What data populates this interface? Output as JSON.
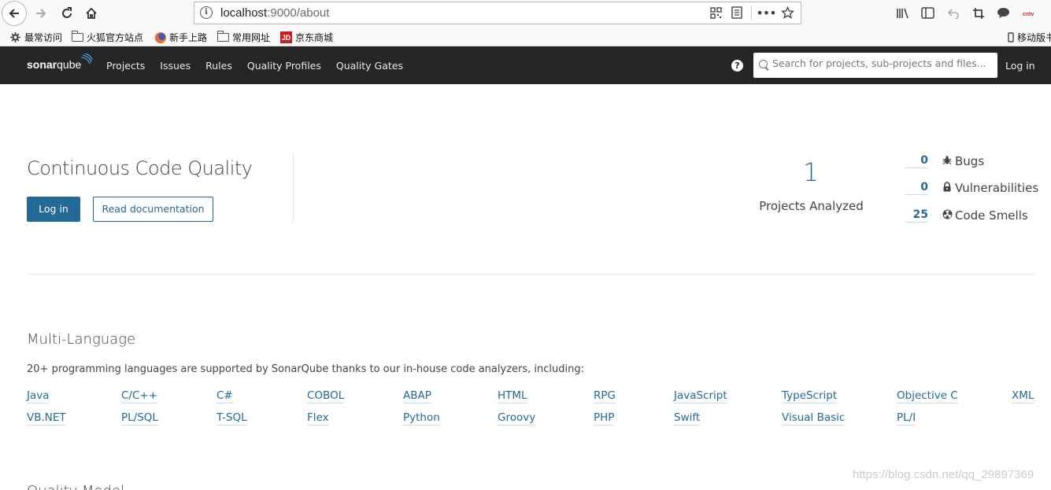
{
  "browser": {
    "url_host": "localhost",
    "url_rest": ":9000/about",
    "bookmarks": [
      {
        "label": "最常访问",
        "icon": "gear-icon"
      },
      {
        "label": "火狐官方站点",
        "icon": "folder-icon"
      },
      {
        "label": "新手上路",
        "icon": "firefox-icon"
      },
      {
        "label": "常用网址",
        "icon": "folder-icon"
      },
      {
        "label": "京东商城",
        "icon": "jd-icon"
      },
      {
        "label": "移动版书",
        "icon": "mobile-icon"
      }
    ]
  },
  "nav": {
    "logo_bold": "sonar",
    "logo_rest": "qube",
    "items": [
      "Projects",
      "Issues",
      "Rules",
      "Quality Profiles",
      "Quality Gates"
    ],
    "search_placeholder": "Search for projects, sub-projects and files...",
    "login": "Log in"
  },
  "hero": {
    "title": "Continuous Code Quality",
    "login_button": "Log in",
    "docs_button": "Read documentation",
    "projects_count": "1",
    "projects_label": "Projects Analyzed",
    "metrics": [
      {
        "value": "0",
        "label": "Bugs",
        "icon": "bug-icon"
      },
      {
        "value": "0",
        "label": "Vulnerabilities",
        "icon": "lock-icon"
      },
      {
        "value": "25",
        "label": "Code Smells",
        "icon": "code-smell-icon"
      }
    ]
  },
  "languages": {
    "title": "Multi-Language",
    "description": "20+ programming languages are supported by SonarQube thanks to our in-house code analyzers, including:",
    "row1": [
      "Java",
      "C/C++",
      "C#",
      "COBOL",
      "ABAP",
      "HTML",
      "RPG",
      "JavaScript",
      "TypeScript",
      "Objective C",
      "XML"
    ],
    "row2": [
      "VB.NET",
      "PL/SQL",
      "T-SQL",
      "Flex",
      "Python",
      "Groovy",
      "PHP",
      "Swift",
      "Visual Basic",
      "PL/I"
    ]
  },
  "next_section_title": "Quality Model",
  "watermark": "https://blog.csdn.net/qq_29897369"
}
